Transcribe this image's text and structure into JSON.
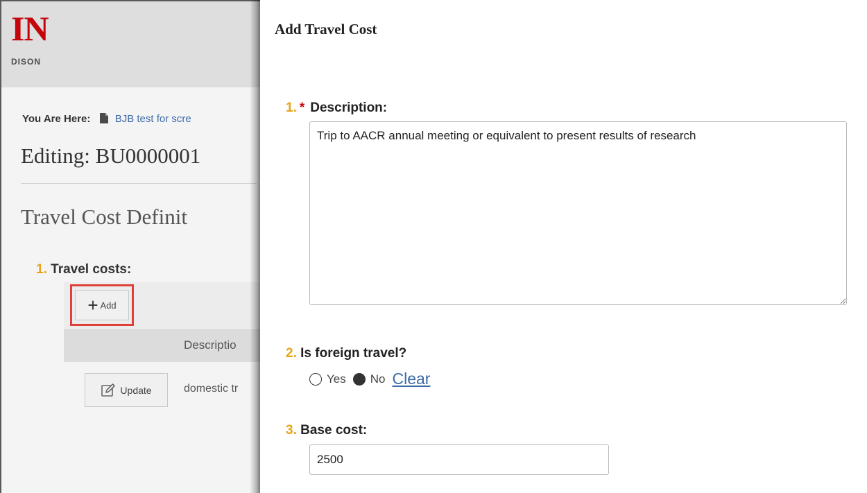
{
  "background_page": {
    "logo_letters": "IN",
    "logo_subtext": "DISON",
    "breadcrumb": {
      "label": "You Are Here:",
      "link": "BJB test for scre"
    },
    "editing_title": "Editing: BU0000001",
    "section_title": "Travel Cost Definit",
    "question": {
      "number": "1.",
      "label": "Travel costs:"
    },
    "add_button_label": "Add",
    "table": {
      "header_description": "Descriptio",
      "rows": [
        {
          "update_label": "Update",
          "description": "domestic tr"
        }
      ]
    }
  },
  "panel": {
    "title": "Add Travel Cost",
    "q1": {
      "number": "1.",
      "required": "*",
      "label": "Description:",
      "value": "Trip to AACR annual meeting or equivalent to present results of research"
    },
    "q2": {
      "number": "2.",
      "label": "Is foreign travel?",
      "options": [
        "Yes",
        "No"
      ],
      "selected": "No",
      "clear_label": "Clear"
    },
    "q3": {
      "number": "3.",
      "label": "Base cost:",
      "value": "2500"
    }
  },
  "colors": {
    "question_number": "#e8a317",
    "required": "#c5050c",
    "link": "#3b6aa8",
    "highlight": "#e0403a"
  }
}
